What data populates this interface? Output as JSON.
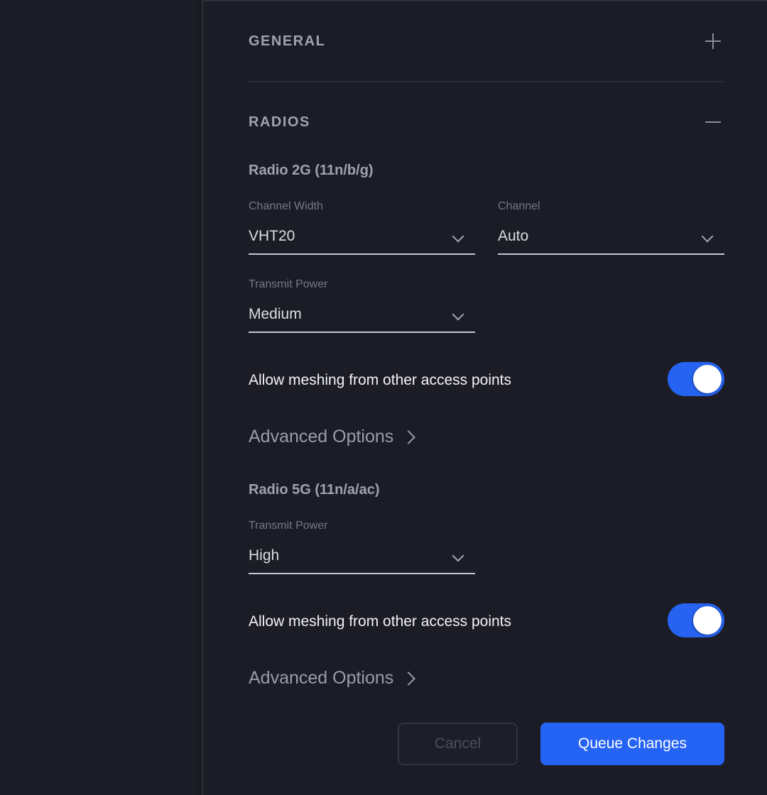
{
  "sections": {
    "general": {
      "title": "GENERAL",
      "expanded": false,
      "icon": "plus-icon"
    },
    "radios": {
      "title": "RADIOS",
      "expanded": true,
      "icon": "minus-icon"
    }
  },
  "radio2g": {
    "title": "Radio 2G (11n/b/g)",
    "channel_width": {
      "label": "Channel Width",
      "value": "VHT20"
    },
    "channel": {
      "label": "Channel",
      "value": "Auto"
    },
    "transmit_power": {
      "label": "Transmit Power",
      "value": "Medium"
    },
    "meshing": {
      "label": "Allow meshing from other access points",
      "enabled": true
    },
    "advanced": {
      "label": "Advanced Options"
    }
  },
  "radio5g": {
    "title": "Radio 5G (11n/a/ac)",
    "transmit_power": {
      "label": "Transmit Power",
      "value": "High"
    },
    "meshing": {
      "label": "Allow meshing from other access points",
      "enabled": true
    },
    "advanced": {
      "label": "Advanced Options"
    }
  },
  "footer": {
    "cancel_label": "Cancel",
    "queue_label": "Queue Changes"
  },
  "colors": {
    "accent": "#2563f5",
    "background": "#1c1c26"
  }
}
